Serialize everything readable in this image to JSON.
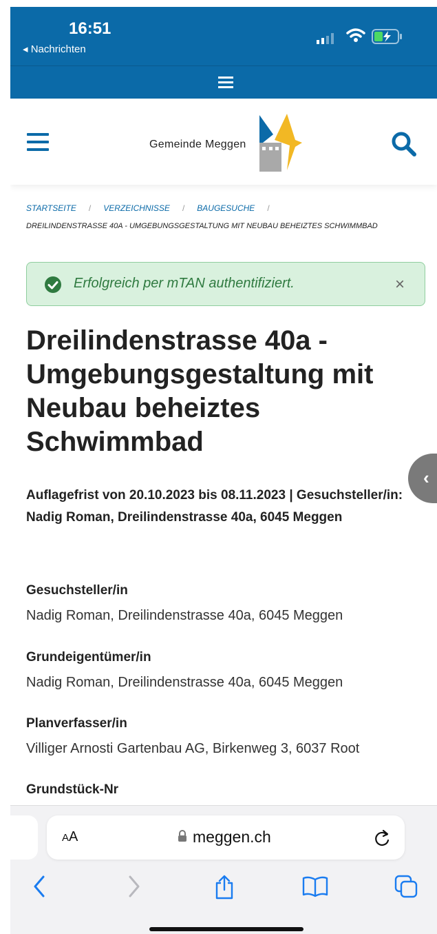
{
  "status": {
    "time": "16:51",
    "back_label": "◂ Nachrichten"
  },
  "header": {
    "site_name": "Gemeinde Meggen"
  },
  "breadcrumb": {
    "items": [
      "STARTSEITE",
      "VERZEICHNISSE",
      "BAUGESUCHE"
    ],
    "current": "DREILINDENSTRASSE 40A - UMGEBUNGSGESTALTUNG MIT NEUBAU BEHEIZTES SCHWIMMBAD"
  },
  "alert": {
    "message": "Erfolgreich per mTAN authentifiziert.",
    "close": "×"
  },
  "page": {
    "title": "Dreilindenstrasse 40a - Umgebungsgestaltung mit Neubau beheiztes Schwimmbad",
    "subtitle": "Auflagefrist von 20.10.2023 bis 08.11.2023 | Gesuchsteller/in: Nadig Roman, Dreilindenstrasse 40a, 6045 Meggen"
  },
  "fields": [
    {
      "label": "Gesuchsteller/in",
      "value": "Nadig Roman, Dreilindenstrasse 40a, 6045 Meggen"
    },
    {
      "label": "Grundeigentümer/in",
      "value": "Nadig Roman, Dreilindenstrasse 40a, 6045 Meggen"
    },
    {
      "label": "Planverfasser/in",
      "value": "Villiger Arnosti Gartenbau AG, Birkenweg 3, 6037 Root"
    },
    {
      "label": "Grundstück-Nr",
      "value": ""
    }
  ],
  "sidetab": {
    "icon": "‹"
  },
  "safari": {
    "aa_small": "A",
    "aa_big": "A",
    "url": "meggen.ch"
  },
  "colors": {
    "brand": "#0b6aa8",
    "alert_bg": "#d9f1de",
    "alert_text": "#2f7a40",
    "logo_yellow": "#f2b824",
    "logo_gray": "#a9a9a9"
  }
}
